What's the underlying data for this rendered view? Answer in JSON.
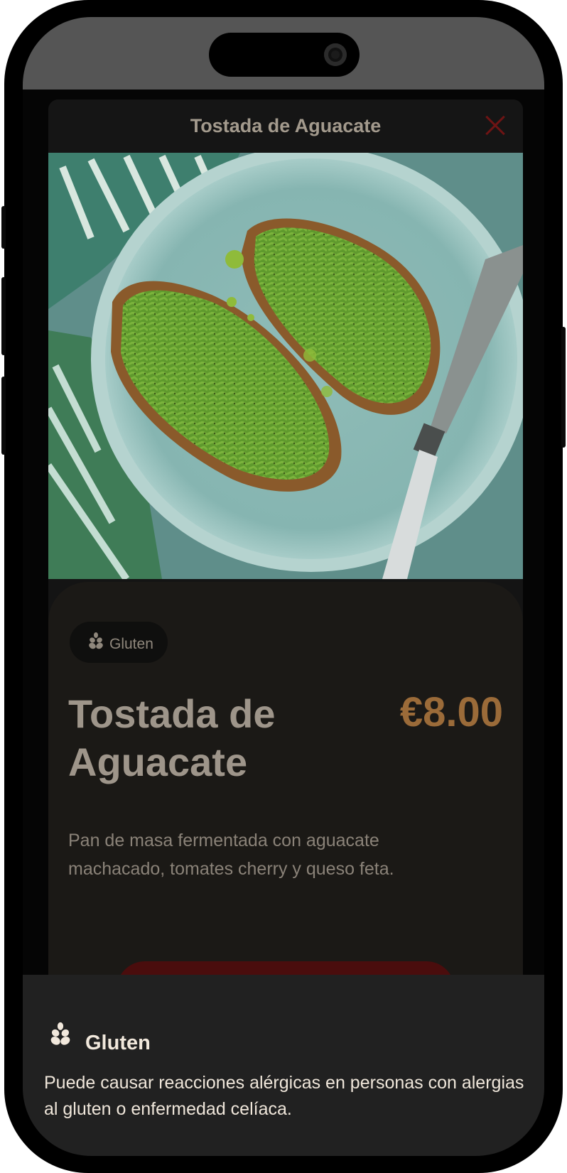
{
  "modal": {
    "title": "Tostada de Aguacate",
    "close_icon": "close-x-icon"
  },
  "dish": {
    "image_alt": "avocado toast photo",
    "allergen_chip": {
      "icon": "wheat-icon",
      "label": "Gluten"
    },
    "name": "Tostada de Aguacate",
    "price": "€8.00",
    "description": "Pan de masa fermentada con aguacate machacado, tomates cherry y queso feta."
  },
  "allergen_sheet": {
    "icon": "wheat-icon",
    "title": "Gluten",
    "text": "Puede causar reacciones alérgicas en personas con alergias al gluten o enfermedad celíaca."
  },
  "colors": {
    "accent_price": "#9b6b39",
    "close_icon": "#6e1414",
    "sheet_background": "#212121",
    "button_background": "#4a0d0d"
  }
}
